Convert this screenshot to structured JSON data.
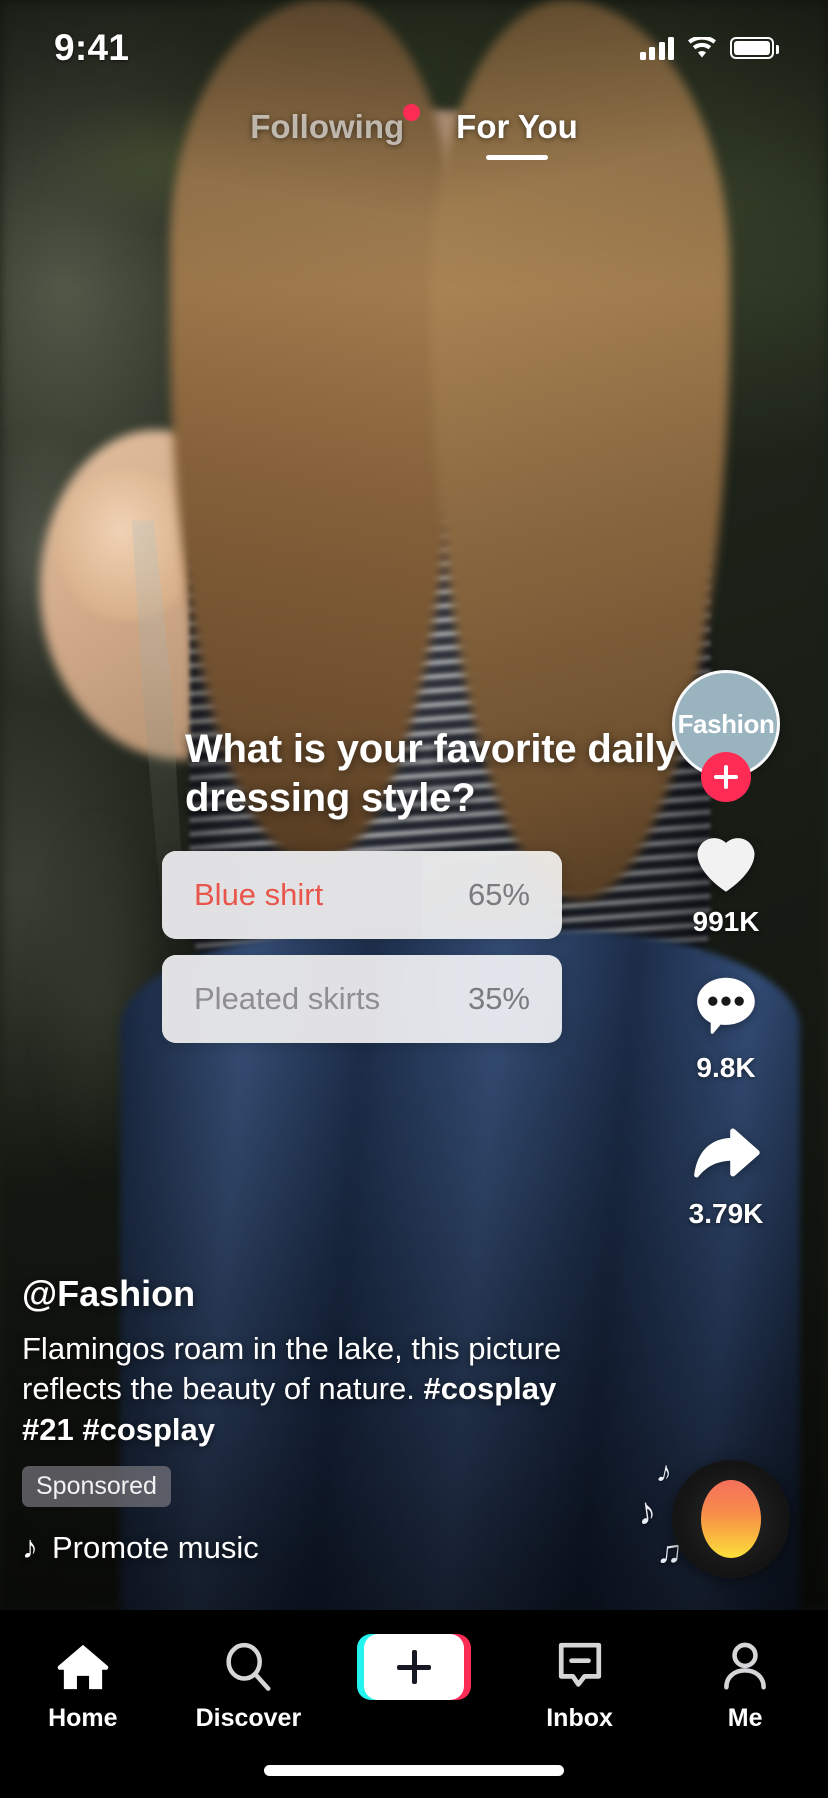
{
  "status_bar": {
    "time": "9:41",
    "cellular_icon": "signal-bars-icon",
    "wifi_icon": "wifi-icon",
    "battery_icon": "battery-icon"
  },
  "top_tabs": {
    "following_label": "Following",
    "foryou_label": "For You",
    "active": "For You",
    "badge_color": "#fe2c55"
  },
  "poll": {
    "question": "What is your favorite daily dressing style?",
    "options": [
      {
        "label": "Blue shirt",
        "percent_label": "65%",
        "percent": 65,
        "leading": true
      },
      {
        "label": "Pleated skirts",
        "percent_label": "35%",
        "percent": 35,
        "leading": false
      }
    ],
    "leading_color": "#e8564b",
    "other_color": "#8e8e93"
  },
  "rail": {
    "avatar_label": "Fashion",
    "avatar_color": "#9ab4bf",
    "follow_icon": "plus-icon",
    "follow_color": "#fe2c55",
    "like": {
      "icon": "heart-icon",
      "count": "991K"
    },
    "comment": {
      "icon": "comment-bubble-icon",
      "count": "9.8K"
    },
    "share": {
      "icon": "share-arrow-icon",
      "count": "3.79K"
    },
    "music_disc_icon": "music-disc-icon"
  },
  "caption": {
    "username": "@Fashion",
    "text": "Flamingos roam in the lake, this picture reflects the beauty of nature. ",
    "hashtags": "#cosplay #21 #cosplay",
    "sponsored_label": "Sponsored",
    "music_icon": "music-note-icon",
    "music_title": "Promote music"
  },
  "bottom_nav": {
    "items": [
      {
        "label": "Home",
        "icon": "home-icon",
        "active": true
      },
      {
        "label": "Discover",
        "icon": "search-icon",
        "active": false
      },
      {
        "label": "",
        "icon": "create-plus-icon",
        "active": false
      },
      {
        "label": "Inbox",
        "icon": "inbox-message-icon",
        "active": false
      },
      {
        "label": "Me",
        "icon": "person-icon",
        "active": false
      }
    ],
    "create_left_color": "#25f4ee",
    "create_right_color": "#fe2c55"
  }
}
